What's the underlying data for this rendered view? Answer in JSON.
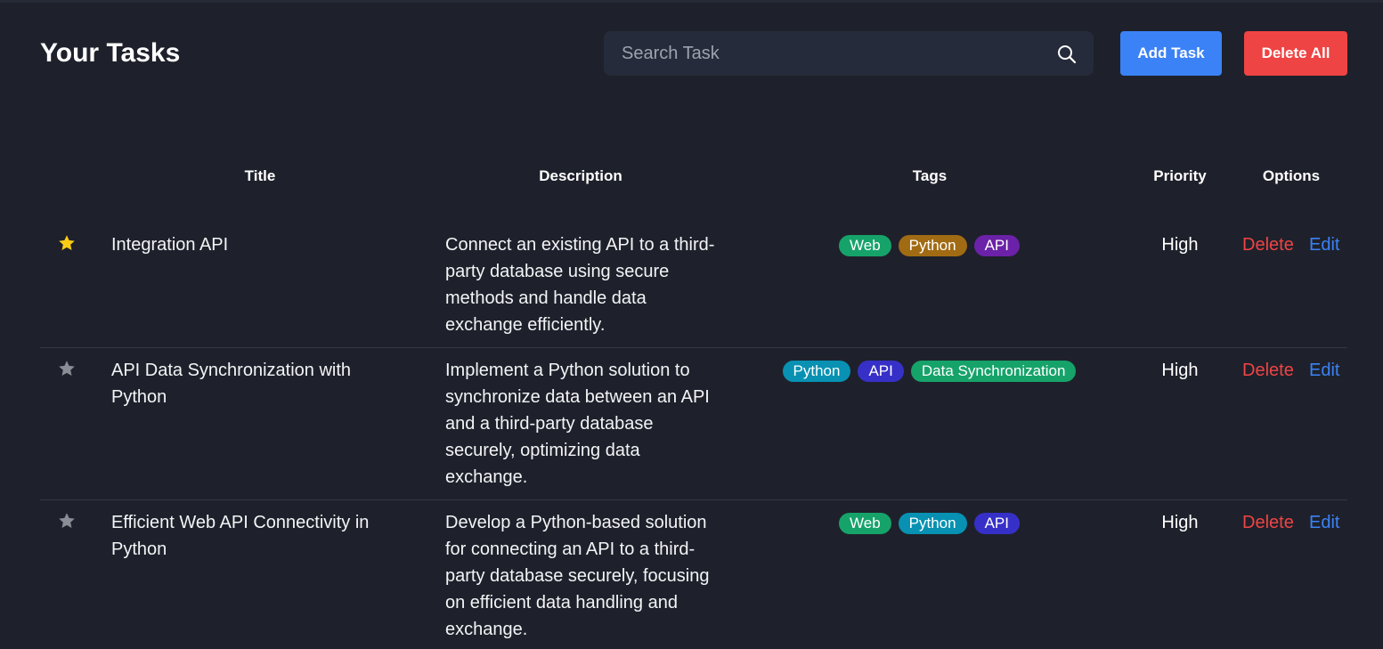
{
  "header": {
    "title": "Your Tasks",
    "search_placeholder": "Search Task",
    "search_value": "",
    "add_label": "Add Task",
    "delete_all_label": "Delete All"
  },
  "columns": {
    "title": "Title",
    "description": "Description",
    "tags": "Tags",
    "priority": "Priority",
    "options": "Options"
  },
  "tasks": [
    {
      "starred": true,
      "title": "Integration API",
      "description": "Connect an existing API to a third-party database using secure methods and handle data exchange efficiently.",
      "tags": [
        {
          "label": "Web",
          "color": "#16a36a"
        },
        {
          "label": "Python",
          "color": "#a16b14"
        },
        {
          "label": "API",
          "color": "#6b21a8"
        }
      ],
      "priority": "High",
      "delete_label": "Delete",
      "edit_label": "Edit"
    },
    {
      "starred": false,
      "title": "API Data Synchronization with Python",
      "description": "Implement a Python solution to synchronize data between an API and a third-party database securely, optimizing data exchange.",
      "tags": [
        {
          "label": "Python",
          "color": "#0891b2"
        },
        {
          "label": "API",
          "color": "#3730c8"
        },
        {
          "label": "Data Synchronization",
          "color": "#16a36a"
        }
      ],
      "priority": "High",
      "delete_label": "Delete",
      "edit_label": "Edit"
    },
    {
      "starred": false,
      "title": "Efficient Web API Connectivity in Python",
      "description": "Develop a Python-based solution for connecting an API to a third-party database securely, focusing on efficient data handling and exchange.",
      "tags": [
        {
          "label": "Web",
          "color": "#16a36a"
        },
        {
          "label": "Python",
          "color": "#0891b2"
        },
        {
          "label": "API",
          "color": "#3730c8"
        }
      ],
      "priority": "High",
      "delete_label": "Delete",
      "edit_label": "Edit"
    }
  ],
  "colors": {
    "background": "#1e212b",
    "star_active": "#facc15",
    "star_inactive": "#8a8d96",
    "add_button": "#3b82f6",
    "delete_button": "#ef4444"
  },
  "icons": {
    "search": "search-icon",
    "star": "star-icon"
  }
}
